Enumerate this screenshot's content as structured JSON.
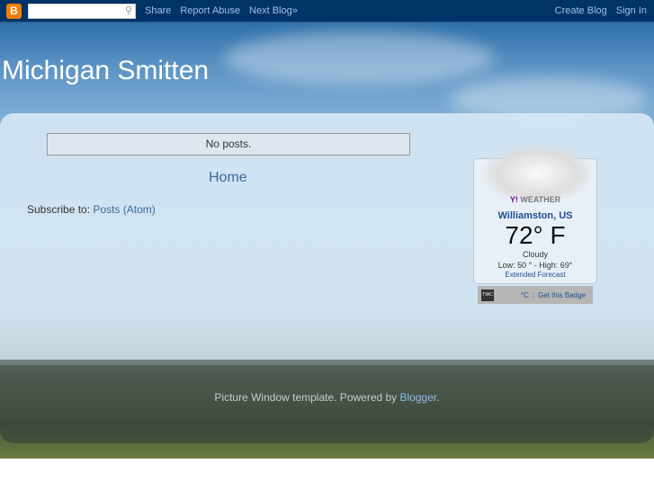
{
  "navbar": {
    "search_placeholder": "",
    "links": [
      "Share",
      "Report Abuse",
      "Next Blog»"
    ],
    "right": [
      "Create Blog",
      "Sign In"
    ]
  },
  "blog": {
    "title": "Michigan Smitten",
    "no_posts": "No posts.",
    "home": "Home",
    "subscribe_label": "Subscribe to:",
    "subscribe_link": "Posts (Atom)"
  },
  "weather": {
    "brand": "Y!",
    "brand_text": "WEATHER",
    "city": "Williamston, US",
    "temp": "72° F",
    "condition": "Cloudy",
    "low_high": "Low: 50 ° - High: 69°",
    "extended": "Extended Forecast",
    "twc": "TWC",
    "unit_toggle": "°C",
    "separator": "|",
    "badge": "Get this Badge"
  },
  "footer": {
    "text": "Picture Window template. Powered by ",
    "link": "Blogger",
    "end": "."
  }
}
